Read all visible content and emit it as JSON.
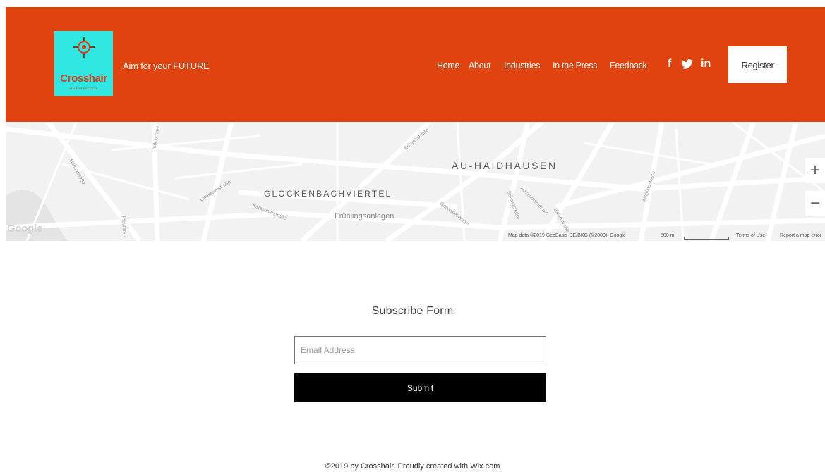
{
  "header": {
    "logo": {
      "name": "Crosshair",
      "subtitle": "AIM FOR SUCCESS"
    },
    "tagline": "Aim for your FUTURE",
    "nav": [
      {
        "label": "Home"
      },
      {
        "label": "About"
      },
      {
        "label": "Industries"
      },
      {
        "label": "In the Press"
      },
      {
        "label": "Feedback"
      }
    ],
    "social": [
      {
        "icon": "facebook-icon",
        "glyph": "f"
      },
      {
        "icon": "twitter-icon",
        "glyph": "🐦"
      },
      {
        "icon": "linkedin-icon",
        "glyph": "in"
      }
    ],
    "register_label": "Register",
    "colors": {
      "bar": "#e0440e",
      "logo_bg": "#2fe6e0",
      "logo_text": "#d6401a"
    }
  },
  "map": {
    "districts": [
      "AU-HAIDHAUSEN",
      "GLOCKENBACHVIERTEL"
    ],
    "park": "Frühlingsanlagen",
    "streets": [
      "Erhardtstraße",
      "Lindwurmstraße",
      "Kapuzinerstraße",
      "Baaderstraße",
      "Rosenheimer Str.",
      "Balanstraße",
      "Gebsattelstraße",
      "Ampfingstraße",
      "Thalkirchner",
      "Pfeuferstr.",
      "Hansastraße"
    ],
    "google_logo": "Google",
    "attribution": "Map data ©2019 GeoBasis-DE/BKG (©2009), Google",
    "scale_label": "500 m",
    "terms": "Terms of Use",
    "report": "Report a map error",
    "zoom_in": "+",
    "zoom_out": "−"
  },
  "form": {
    "title": "Subscribe Form",
    "email_placeholder": "Email Address",
    "email_value": "",
    "submit_label": "Submit"
  },
  "footer": {
    "text": "©2019 by Crosshair. Proudly created with Wix.com"
  }
}
